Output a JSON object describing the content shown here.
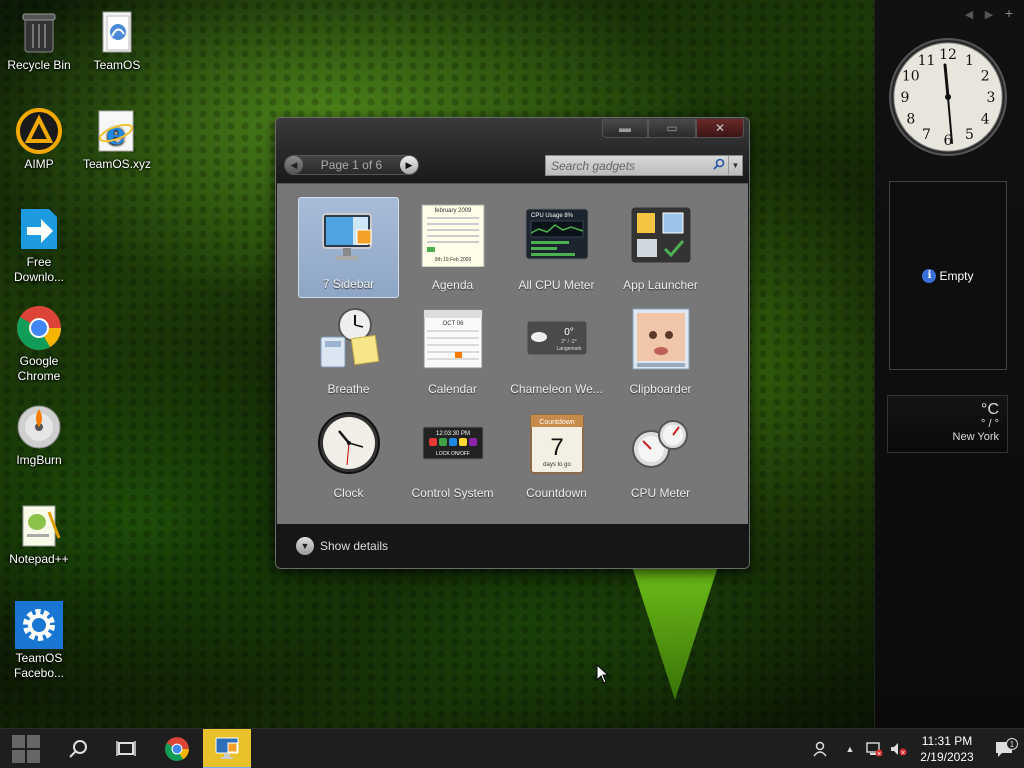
{
  "desktop": {
    "icons": [
      {
        "label": "Recycle Bin",
        "icon": "recycle-bin-icon"
      },
      {
        "label": "TeamOS",
        "icon": "teamos-folder-icon"
      },
      {
        "label": "AIMP",
        "icon": "aimp-icon"
      },
      {
        "label": "TeamOS.xyz",
        "icon": "internet-explorer-icon"
      },
      {
        "label": "Free Downlo...",
        "icon": "free-download-manager-icon"
      },
      {
        "label": "Google Chrome",
        "icon": "chrome-icon"
      },
      {
        "label": "ImgBurn",
        "icon": "imgburn-icon"
      },
      {
        "label": "Notepad++",
        "icon": "notepadpp-icon"
      },
      {
        "label": "TeamOS Facebo...",
        "icon": "teamos-facebook-gear-icon"
      }
    ]
  },
  "sidebar": {
    "nav": {
      "prev": "◀",
      "next": "▶",
      "add": "+"
    },
    "clock": {
      "numbers": [
        "12",
        "1",
        "2",
        "3",
        "4",
        "5",
        "6",
        "7",
        "8",
        "9",
        "10",
        "11"
      ]
    },
    "empty_gadget": {
      "info_glyph": "i",
      "label": "Empty"
    },
    "weather": {
      "degrees": "°C",
      "range": "° / °",
      "city": "New York"
    }
  },
  "gadget_window": {
    "window_buttons": {
      "minimize": "▬",
      "maximize": "▭",
      "close": "✕"
    },
    "pager": {
      "text": "Page 1 of 6",
      "prev": "◀",
      "next": "▶"
    },
    "search": {
      "placeholder": "Search gadgets",
      "icon": "search-icon",
      "dropdown": "▼"
    },
    "gadgets": [
      {
        "label": "7 Sidebar",
        "selected": true
      },
      {
        "label": "Agenda",
        "selected": false,
        "header": "february 2009",
        "footer": "9th 19 Feb 2009"
      },
      {
        "label": "All CPU Meter",
        "selected": false,
        "header": "CPU Usage 8%"
      },
      {
        "label": "App Launcher",
        "selected": false
      },
      {
        "label": "Breathe",
        "selected": false
      },
      {
        "label": "Calendar",
        "selected": false,
        "header": "OCT 06"
      },
      {
        "label": "Chameleon We...",
        "selected": false,
        "temp": "0°",
        "range": "2° / -2°",
        "city": "Langemark"
      },
      {
        "label": "Clipboarder",
        "selected": false
      },
      {
        "label": "Clock",
        "selected": false
      },
      {
        "label": "Control System",
        "selected": false,
        "time": "12:03:30 PM",
        "lock": "LOCK ON/OFF"
      },
      {
        "label": "Countdown",
        "selected": false,
        "title": "Countdown",
        "number": "7",
        "caption": "days to go"
      },
      {
        "label": "CPU Meter",
        "selected": false
      }
    ],
    "details": {
      "chevron": "▼",
      "label": "Show details"
    }
  },
  "taskbar": {
    "time": "11:31 PM",
    "date": "2/19/2023",
    "notification_count": "1",
    "tray_up": "▲"
  }
}
